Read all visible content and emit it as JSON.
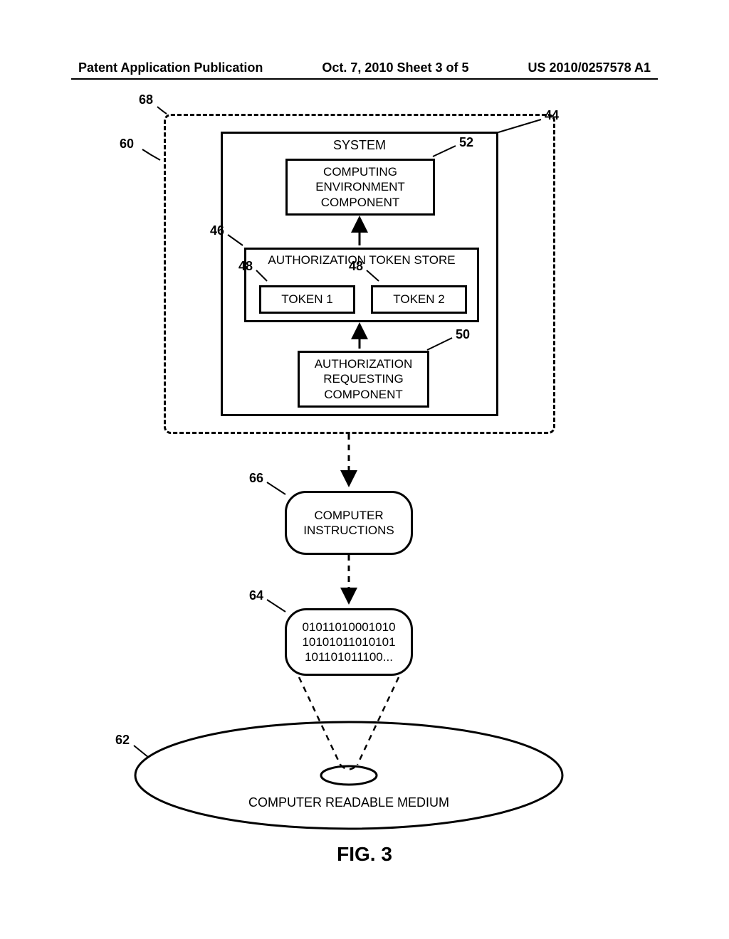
{
  "header": {
    "left": "Patent Application Publication",
    "center": "Oct. 7, 2010  Sheet 3 of 5",
    "right": "US 2010/0257578 A1"
  },
  "refs": {
    "r68": "68",
    "r60": "60",
    "r44": "44",
    "r52": "52",
    "r46": "46",
    "r48a": "48",
    "r48b": "48",
    "r50": "50",
    "r66": "66",
    "r64": "64",
    "r62": "62"
  },
  "boxes": {
    "system_title": "SYSTEM",
    "comp_env": "COMPUTING ENVIRONMENT COMPONENT",
    "auth_store": "AUTHORIZATION TOKEN STORE",
    "token1": "TOKEN 1",
    "token2": "TOKEN 2",
    "auth_req": "AUTHORIZATION REQUESTING COMPONENT",
    "ci": "COMPUTER INSTRUCTIONS",
    "bits1": "01011010001010",
    "bits2": "10101011010101",
    "bits3": "101101011100...",
    "medium": "COMPUTER READABLE MEDIUM"
  },
  "figure": "FIG. 3"
}
